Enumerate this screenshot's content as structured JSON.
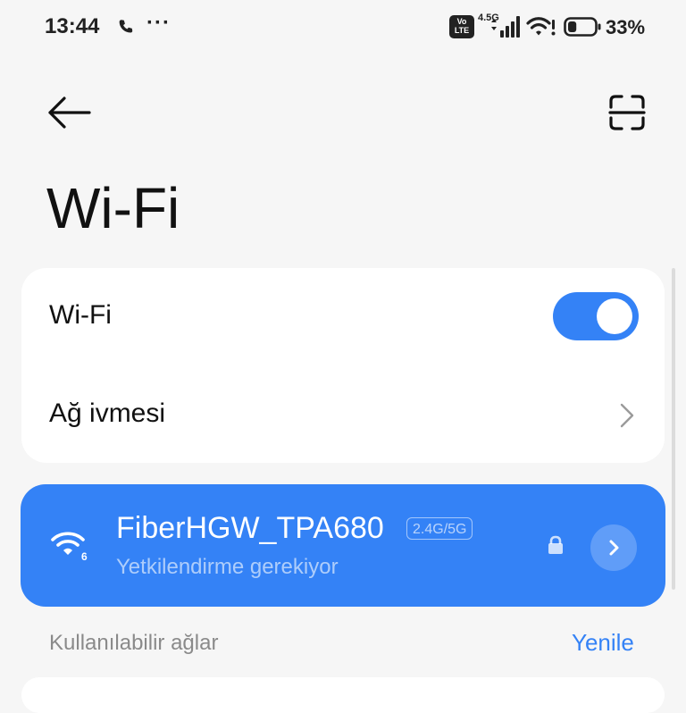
{
  "status_bar": {
    "time": "13:44",
    "more_dots": "···",
    "volte_top": "Vo",
    "volte_bottom": "LTE",
    "network": "4.5G",
    "battery_pct": "33%",
    "battery_level": 0.33,
    "icons": [
      "phone-icon",
      "signal-icon",
      "wifi-icon",
      "battery-icon"
    ]
  },
  "header": {
    "back_icon": "arrow-left-icon",
    "scan_icon": "scan-qr-icon",
    "title": "Wi-Fi"
  },
  "settings": {
    "wifi_label": "Wi-Fi",
    "wifi_enabled": true,
    "acceleration_label": "Ağ ivmesi"
  },
  "connected_network": {
    "ssid": "FiberHGW_TPA680",
    "band": "2.4G/5G",
    "status": "Yetkilendirme gerekiyor",
    "wifi_badge": "6",
    "secured": true
  },
  "available": {
    "label": "Kullanılabilir ağlar",
    "refresh": "Yenile"
  },
  "colors": {
    "accent": "#3482f6",
    "background": "#f6f6f6",
    "card": "#ffffff"
  }
}
